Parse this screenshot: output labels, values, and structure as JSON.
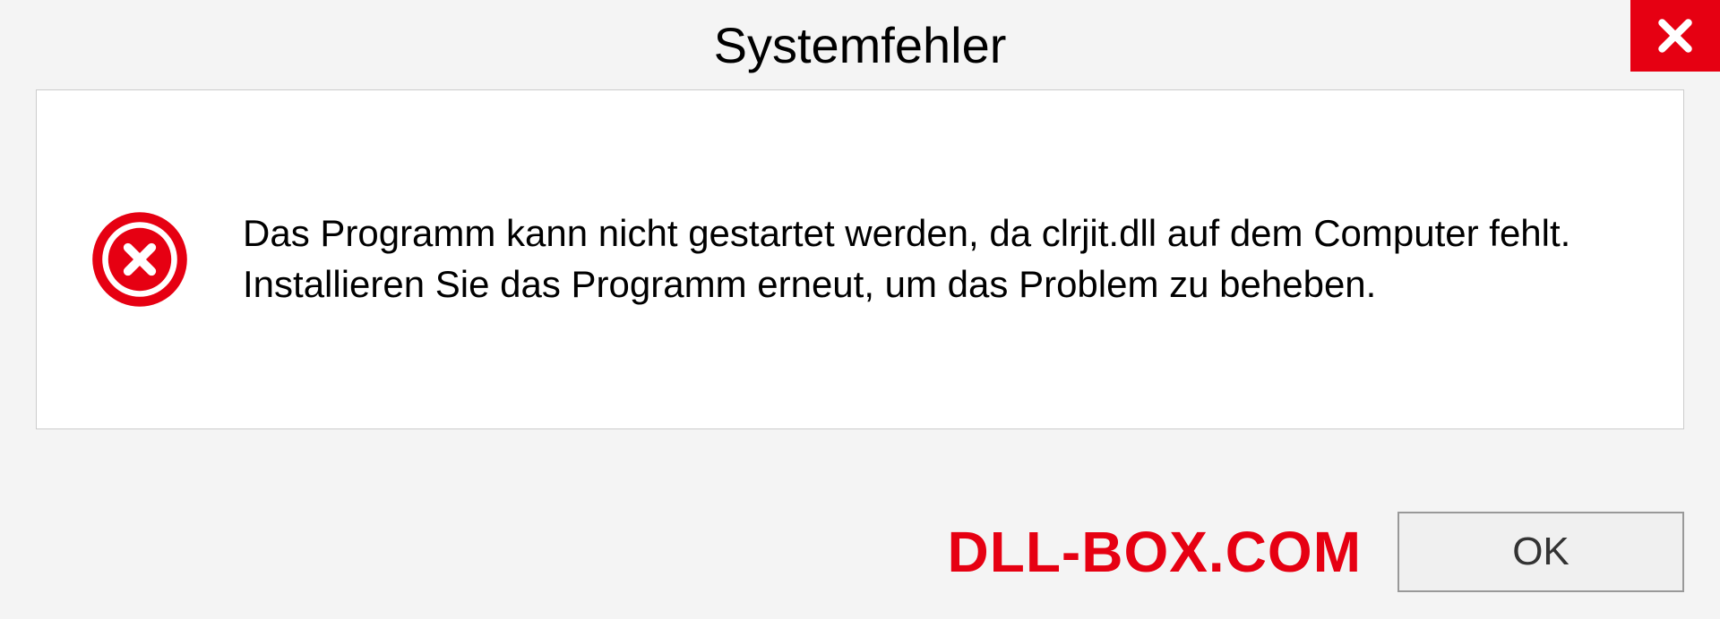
{
  "titlebar": {
    "title": "Systemfehler"
  },
  "content": {
    "message": "Das Programm kann nicht gestartet werden, da clrjit.dll auf dem Computer fehlt. Installieren Sie das Programm erneut, um das Problem zu beheben."
  },
  "footer": {
    "watermark": "DLL-BOX.COM",
    "ok_label": "OK"
  },
  "icons": {
    "close": "close-icon",
    "error": "error-circle-icon"
  },
  "colors": {
    "accent_red": "#e60012",
    "bg": "#f4f4f4",
    "panel": "#ffffff",
    "border": "#cccccc"
  }
}
